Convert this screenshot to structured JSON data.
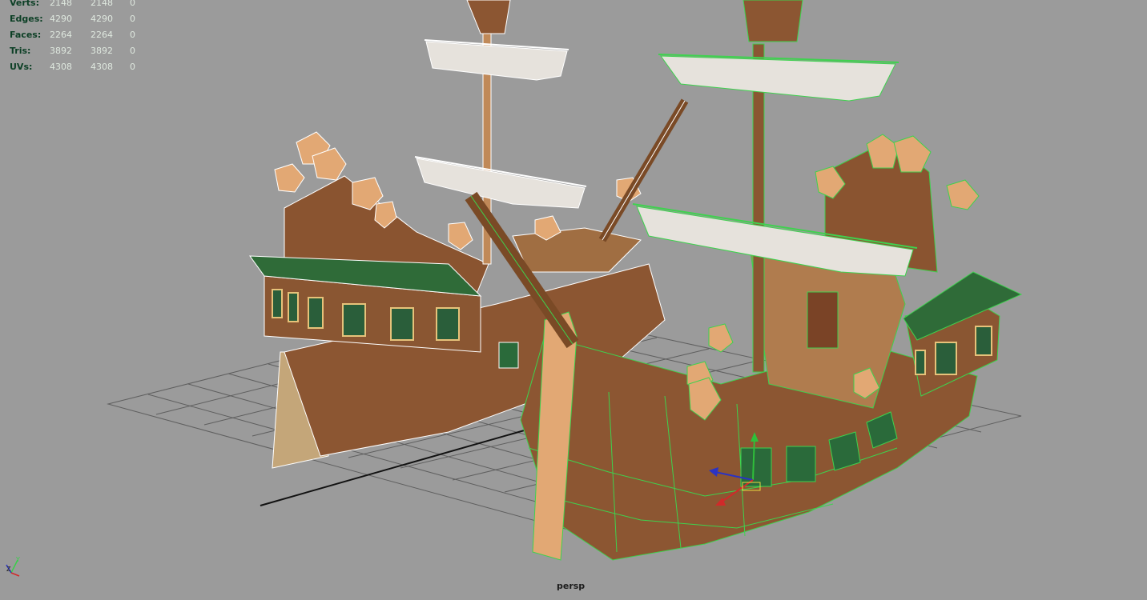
{
  "hud": {
    "rows": [
      {
        "label": "Verts:",
        "c1": "2148",
        "c2": "2148",
        "c3": "0"
      },
      {
        "label": "Edges:",
        "c1": "4290",
        "c2": "4290",
        "c3": "0"
      },
      {
        "label": "Faces:",
        "c1": "2264",
        "c2": "2264",
        "c3": "0"
      },
      {
        "label": "Tris:",
        "c1": "3892",
        "c2": "3892",
        "c3": "0"
      },
      {
        "label": "UVs:",
        "c1": "4308",
        "c2": "4308",
        "c3": "0"
      }
    ]
  },
  "viewport": {
    "camera": "persp",
    "background": "#9b9b9b",
    "grid_color": "#5e5e5e",
    "wire_unselected": "#ffffff",
    "wire_selected": "#3ed24e",
    "wood_color": "#8c5632",
    "sail_color": "#e6e2dc",
    "roof_color": "#2e6b3a"
  },
  "axis": {
    "y": "Y",
    "z": "Z",
    "x": "X"
  }
}
